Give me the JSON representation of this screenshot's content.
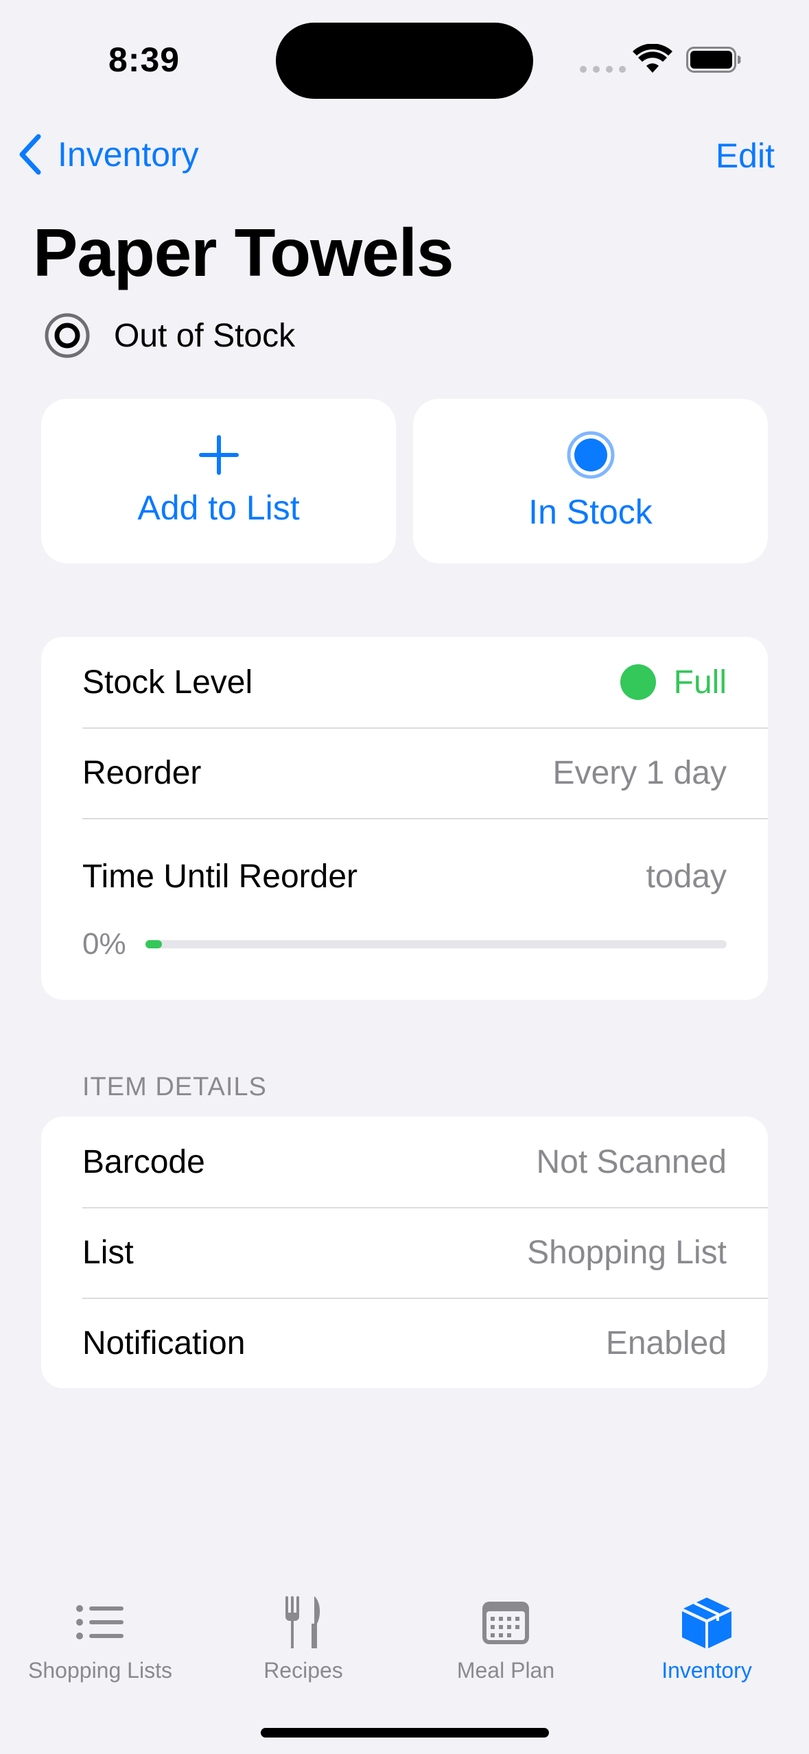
{
  "status_bar": {
    "time": "8:39"
  },
  "nav": {
    "back_label": "Inventory",
    "edit_label": "Edit"
  },
  "item": {
    "title": "Paper Towels",
    "status_label": "Out of Stock"
  },
  "actions": {
    "add_to_list": "Add to List",
    "in_stock": "In Stock"
  },
  "stock": {
    "level_label": "Stock Level",
    "level_value": "Full",
    "reorder_label": "Reorder",
    "reorder_value": "Every 1 day",
    "time_label": "Time Until Reorder",
    "time_value": "today",
    "progress_text": "0%",
    "progress_fraction": 0
  },
  "details": {
    "header": "ITEM DETAILS",
    "barcode_label": "Barcode",
    "barcode_value": "Not Scanned",
    "list_label": "List",
    "list_value": "Shopping List",
    "notification_label": "Notification",
    "notification_value": "Enabled"
  },
  "tabs": [
    {
      "label": "Shopping Lists",
      "icon": "list-icon",
      "active": false
    },
    {
      "label": "Recipes",
      "icon": "fork-knife-icon",
      "active": false
    },
    {
      "label": "Meal Plan",
      "icon": "calendar-icon",
      "active": false
    },
    {
      "label": "Inventory",
      "icon": "box-icon",
      "active": true
    }
  ],
  "colors": {
    "accent": "#0A7AFF",
    "success": "#34C759",
    "secondary_text": "#8A8A8E",
    "background": "#F2F2F7"
  }
}
